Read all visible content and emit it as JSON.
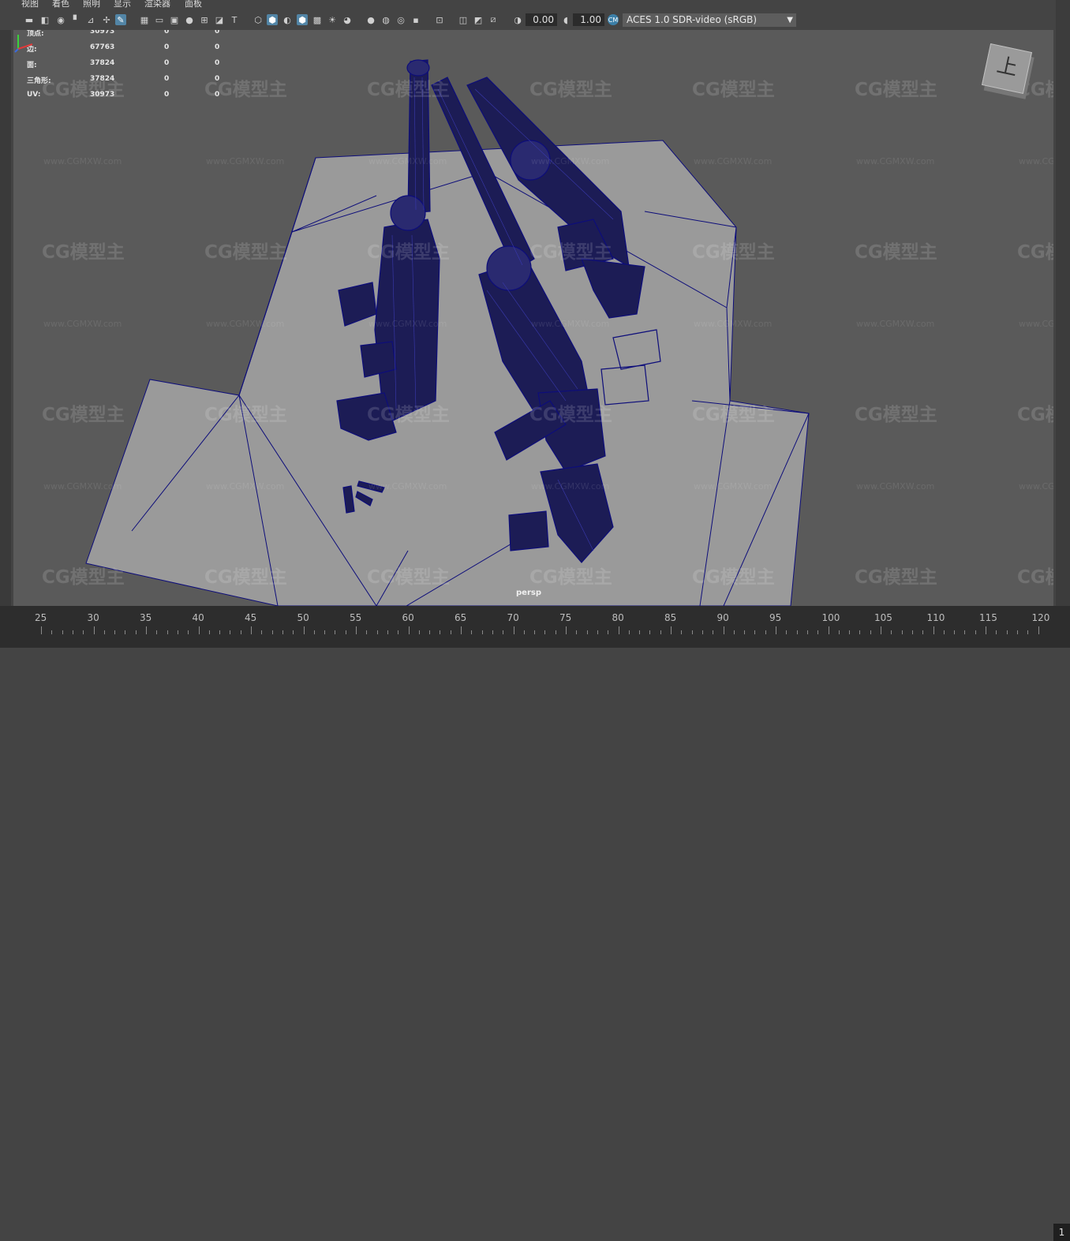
{
  "menu": {
    "items": [
      "视图",
      "着色",
      "照明",
      "显示",
      "渲染器",
      "面板"
    ]
  },
  "toolbar": {
    "exposure_value": "0.00",
    "gamma_value": "1.00",
    "color_space": "ACES 1.0 SDR-video (sRGB)",
    "icons": [
      "camera-select-icon",
      "camera-attr-icon",
      "bookmark-icon",
      "image-plane-icon",
      "grid-icon",
      "film-gate-icon",
      "resolution-gate-icon",
      "wireframe-icon",
      "smooth-shade-icon",
      "wireframe-on-shaded-icon",
      "textured-icon",
      "lights-icon",
      "shadows-icon",
      "ambient-occlusion-icon",
      "isolate-icon",
      "xray-icon",
      "exposure-icon",
      "gamma-icon",
      "color-manage-icon"
    ]
  },
  "hud": {
    "rows": [
      {
        "label": "顶点:",
        "v1": "30973",
        "v2": "0",
        "v3": "0"
      },
      {
        "label": "边:",
        "v1": "67763",
        "v2": "0",
        "v3": "0"
      },
      {
        "label": "面:",
        "v1": "37824",
        "v2": "0",
        "v3": "0"
      },
      {
        "label": "三角形:",
        "v1": "37824",
        "v2": "0",
        "v3": "0"
      },
      {
        "label": "UV:",
        "v1": "30973",
        "v2": "0",
        "v3": "0"
      }
    ]
  },
  "viewport": {
    "camera": "persp",
    "view_cube_label": "上",
    "watermark_logo": "CG模型主",
    "watermark_url": "www.CGMXW.com"
  },
  "timeline": {
    "labels": [
      "25",
      "30",
      "35",
      "40",
      "45",
      "50",
      "55",
      "60",
      "65",
      "70",
      "75",
      "80",
      "85",
      "90",
      "95",
      "100",
      "105",
      "110",
      "115",
      "120"
    ],
    "current_frame": "1"
  },
  "colors": {
    "wire": "#0d0d7a",
    "floor": "#9a9a9a",
    "viewport_bg": "#5a5a5a",
    "accent": "#5285a6"
  }
}
